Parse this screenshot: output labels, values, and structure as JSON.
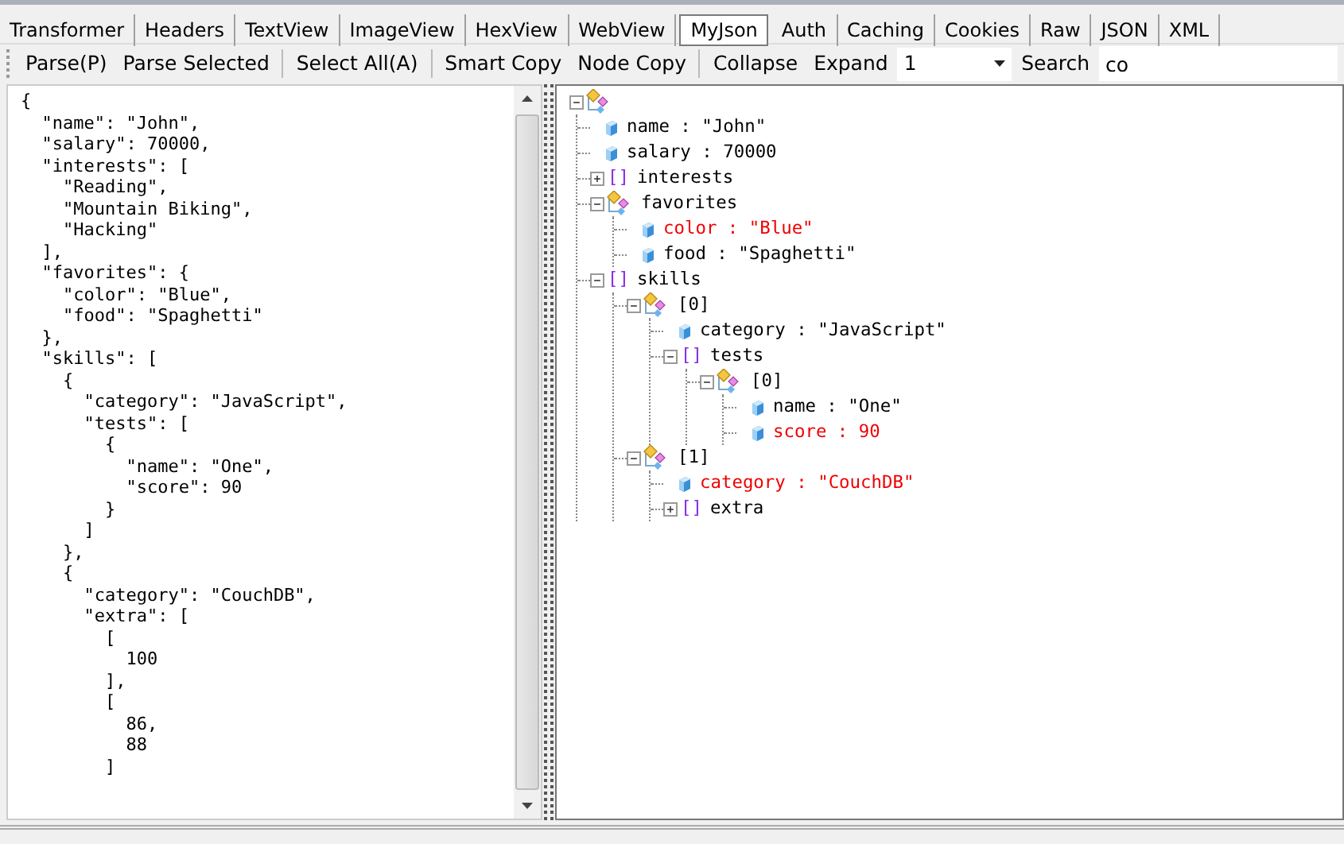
{
  "tabs": [
    {
      "label": "Transformer",
      "selected": false
    },
    {
      "label": "Headers",
      "selected": false
    },
    {
      "label": "TextView",
      "selected": false
    },
    {
      "label": "ImageView",
      "selected": false
    },
    {
      "label": "HexView",
      "selected": false
    },
    {
      "label": "WebView",
      "selected": false
    },
    {
      "label": "MyJson",
      "selected": true
    },
    {
      "label": "Auth",
      "selected": false
    },
    {
      "label": "Caching",
      "selected": false
    },
    {
      "label": "Cookies",
      "selected": false
    },
    {
      "label": "Raw",
      "selected": false
    },
    {
      "label": "JSON",
      "selected": false
    },
    {
      "label": "XML",
      "selected": false
    }
  ],
  "toolbar": [
    {
      "kind": "button",
      "label": "Parse(P)"
    },
    {
      "kind": "button",
      "label": "Parse Selected"
    },
    {
      "kind": "separator"
    },
    {
      "kind": "button",
      "label": "Select All(A)"
    },
    {
      "kind": "separator"
    },
    {
      "kind": "button",
      "label": "Smart Copy"
    },
    {
      "kind": "button",
      "label": "Node Copy"
    },
    {
      "kind": "separator"
    },
    {
      "kind": "button",
      "label": "Collapse"
    },
    {
      "kind": "button",
      "label": "Expand"
    },
    {
      "kind": "dropdown",
      "value": "1"
    },
    {
      "kind": "button",
      "label": "Search"
    },
    {
      "kind": "input",
      "value": "co"
    }
  ],
  "editor": {
    "lines": [
      "{",
      "  \"name\": \"John\",",
      "  \"salary\": 70000,",
      "  \"interests\": [",
      "    \"Reading\",",
      "    \"Mountain Biking\",",
      "    \"Hacking\"",
      "  ],",
      "  \"favorites\": {",
      "    \"color\": \"Blue\",",
      "    \"food\": \"Spaghetti\"",
      "  },",
      "  \"skills\": [",
      "    {",
      "      \"category\": \"JavaScript\",",
      "      \"tests\": [",
      "        {",
      "          \"name\": \"One\",",
      "          \"score\": 90",
      "        }",
      "      ]",
      "    },",
      "    {",
      "      \"category\": \"CouchDB\",",
      "      \"extra\": [",
      "        [",
      "          100",
      "        ],",
      "        [",
      "          86,",
      "          88",
      "        ]"
    ]
  },
  "tree": [
    {
      "kind": "object",
      "expanded": true,
      "children": [
        {
          "kind": "value",
          "label": "name : \"John\"",
          "match": false
        },
        {
          "kind": "value",
          "label": "salary : 70000",
          "match": false
        },
        {
          "kind": "array",
          "glyph": "[]",
          "label": "interests",
          "expanded": false,
          "match": false
        },
        {
          "kind": "object",
          "label": "favorites",
          "expanded": true,
          "match": false,
          "children": [
            {
              "kind": "value",
              "label": "color : \"Blue\"",
              "match": true
            },
            {
              "kind": "value",
              "label": "food : \"Spaghetti\"",
              "match": false
            }
          ]
        },
        {
          "kind": "array",
          "glyph": "[]",
          "label": "skills",
          "expanded": true,
          "match": false,
          "children": [
            {
              "kind": "object",
              "label": "[0]",
              "expanded": true,
              "match": false,
              "children": [
                {
                  "kind": "value",
                  "label": "category : \"JavaScript\"",
                  "match": false
                },
                {
                  "kind": "array",
                  "glyph": "[]",
                  "label": "tests",
                  "expanded": true,
                  "match": false,
                  "children": [
                    {
                      "kind": "object",
                      "label": "[0]",
                      "expanded": true,
                      "match": false,
                      "children": [
                        {
                          "kind": "value",
                          "label": "name : \"One\"",
                          "match": false
                        },
                        {
                          "kind": "value",
                          "label": "score : 90",
                          "match": true
                        }
                      ]
                    }
                  ]
                }
              ]
            },
            {
              "kind": "object",
              "label": "[1]",
              "expanded": true,
              "match": false,
              "children": [
                {
                  "kind": "value",
                  "label": "category : \"CouchDB\"",
                  "match": true
                },
                {
                  "kind": "array",
                  "glyph": "[]",
                  "label": "extra",
                  "expanded": false,
                  "match": false
                }
              ]
            }
          ]
        }
      ]
    }
  ]
}
